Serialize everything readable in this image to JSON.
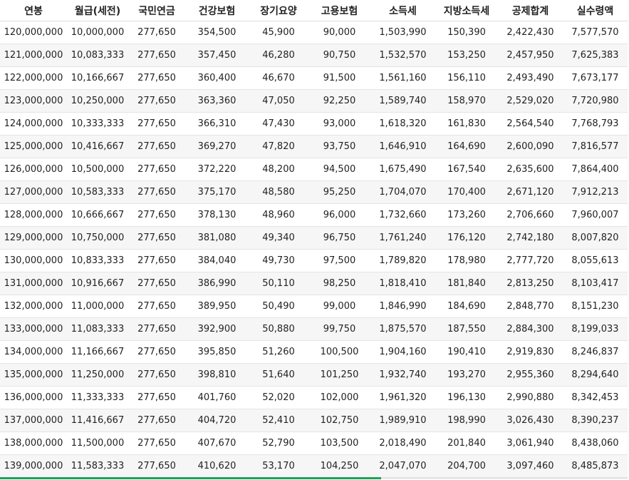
{
  "table": {
    "headers": [
      "연봉",
      "월급(세전)",
      "국민연금",
      "건강보험",
      "장기요양",
      "고용보험",
      "소득세",
      "지방소득세",
      "공제합계",
      "실수령액"
    ],
    "rows": [
      [
        "120,000,000",
        "10,000,000",
        "277,650",
        "354,500",
        "45,900",
        "90,000",
        "1,503,990",
        "150,390",
        "2,422,430",
        "7,577,570"
      ],
      [
        "121,000,000",
        "10,083,333",
        "277,650",
        "357,450",
        "46,280",
        "90,750",
        "1,532,570",
        "153,250",
        "2,457,950",
        "7,625,383"
      ],
      [
        "122,000,000",
        "10,166,667",
        "277,650",
        "360,400",
        "46,670",
        "91,500",
        "1,561,160",
        "156,110",
        "2,493,490",
        "7,673,177"
      ],
      [
        "123,000,000",
        "10,250,000",
        "277,650",
        "363,360",
        "47,050",
        "92,250",
        "1,589,740",
        "158,970",
        "2,529,020",
        "7,720,980"
      ],
      [
        "124,000,000",
        "10,333,333",
        "277,650",
        "366,310",
        "47,430",
        "93,000",
        "1,618,320",
        "161,830",
        "2,564,540",
        "7,768,793"
      ],
      [
        "125,000,000",
        "10,416,667",
        "277,650",
        "369,270",
        "47,820",
        "93,750",
        "1,646,910",
        "164,690",
        "2,600,090",
        "7,816,577"
      ],
      [
        "126,000,000",
        "10,500,000",
        "277,650",
        "372,220",
        "48,200",
        "94,500",
        "1,675,490",
        "167,540",
        "2,635,600",
        "7,864,400"
      ],
      [
        "127,000,000",
        "10,583,333",
        "277,650",
        "375,170",
        "48,580",
        "95,250",
        "1,704,070",
        "170,400",
        "2,671,120",
        "7,912,213"
      ],
      [
        "128,000,000",
        "10,666,667",
        "277,650",
        "378,130",
        "48,960",
        "96,000",
        "1,732,660",
        "173,260",
        "2,706,660",
        "7,960,007"
      ],
      [
        "129,000,000",
        "10,750,000",
        "277,650",
        "381,080",
        "49,340",
        "96,750",
        "1,761,240",
        "176,120",
        "2,742,180",
        "8,007,820"
      ],
      [
        "130,000,000",
        "10,833,333",
        "277,650",
        "384,040",
        "49,730",
        "97,500",
        "1,789,820",
        "178,980",
        "2,777,720",
        "8,055,613"
      ],
      [
        "131,000,000",
        "10,916,667",
        "277,650",
        "386,990",
        "50,110",
        "98,250",
        "1,818,410",
        "181,840",
        "2,813,250",
        "8,103,417"
      ],
      [
        "132,000,000",
        "11,000,000",
        "277,650",
        "389,950",
        "50,490",
        "99,000",
        "1,846,990",
        "184,690",
        "2,848,770",
        "8,151,230"
      ],
      [
        "133,000,000",
        "11,083,333",
        "277,650",
        "392,900",
        "50,880",
        "99,750",
        "1,875,570",
        "187,550",
        "2,884,300",
        "8,199,033"
      ],
      [
        "134,000,000",
        "11,166,667",
        "277,650",
        "395,850",
        "51,260",
        "100,500",
        "1,904,160",
        "190,410",
        "2,919,830",
        "8,246,837"
      ],
      [
        "135,000,000",
        "11,250,000",
        "277,650",
        "398,810",
        "51,640",
        "101,250",
        "1,932,740",
        "193,270",
        "2,955,360",
        "8,294,640"
      ],
      [
        "136,000,000",
        "11,333,333",
        "277,650",
        "401,760",
        "52,020",
        "102,000",
        "1,961,320",
        "196,130",
        "2,990,880",
        "8,342,453"
      ],
      [
        "137,000,000",
        "11,416,667",
        "277,650",
        "404,720",
        "52,410",
        "102,750",
        "1,989,910",
        "198,990",
        "3,026,430",
        "8,390,237"
      ],
      [
        "138,000,000",
        "11,500,000",
        "277,650",
        "407,670",
        "52,790",
        "103,500",
        "2,018,490",
        "201,840",
        "3,061,940",
        "8,438,060"
      ],
      [
        "139,000,000",
        "11,583,333",
        "277,650",
        "410,620",
        "53,170",
        "104,250",
        "2,047,070",
        "204,700",
        "3,097,460",
        "8,485,873"
      ]
    ]
  },
  "scroll": {
    "position_fraction": 0.607
  },
  "colors": {
    "accent": "#1aa35a",
    "stripe": "#f6f6f6"
  }
}
